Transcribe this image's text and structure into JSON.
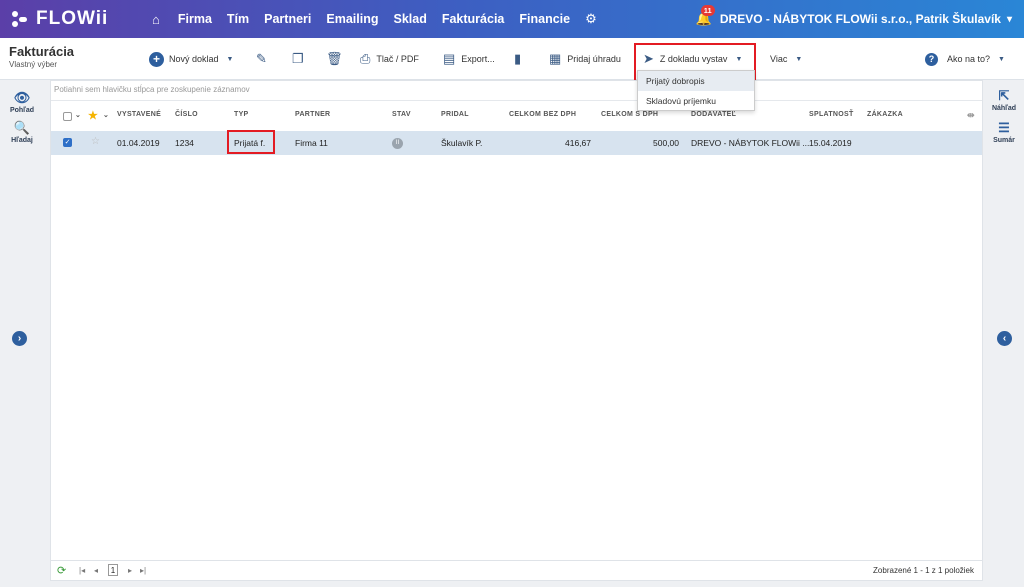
{
  "topbar": {
    "logo_text": "FLOWii",
    "nav": [
      "Firma",
      "Tím",
      "Partneri",
      "Emailing",
      "Sklad",
      "Fakturácia",
      "Financie"
    ],
    "notifications": "11",
    "user": "DREVO - NÁBYTOK FLOWii s.r.o., Patrik Škulavík"
  },
  "page": {
    "title": "Fakturácia",
    "subtitle": "Vlastný výber"
  },
  "toolbar": {
    "new_doc": "Nový doklad",
    "print": "Tlač / PDF",
    "export": "Export...",
    "add_payment": "Pridaj úhradu",
    "from_doc": "Z dokladu vystav",
    "more": "Viac",
    "help": "Ako na to?"
  },
  "dropdown": [
    "Prijatý dobropis",
    "Skladovú príjemku"
  ],
  "rails": {
    "left": {
      "view": "Pohľad",
      "search": "Hľadaj"
    },
    "right": {
      "preview": "Náhľad",
      "summary": "Sumár"
    }
  },
  "grid": {
    "group_hint": "Potiahni sem hlavičku stĺpca pre zoskupenie záznamov",
    "columns": [
      "VYSTAVENÉ",
      "ČÍSLO",
      "TYP",
      "PARTNER",
      "STAV",
      "PRIDAL",
      "CELKOM BEZ DPH",
      "CELKOM S DPH",
      "DODÁVATEĽ",
      "SPLATNOSŤ",
      "ZÁKAZKA"
    ],
    "rows": [
      {
        "issued": "01.04.2019",
        "number": "1234",
        "type": "Prijatá f.",
        "partner": "Firma 11",
        "added_by": "Škulavík P.",
        "total_net": "416,67",
        "total_gross": "500,00",
        "supplier": "DREVO - NÁBYTOK FLOWii ...",
        "due": "15.04.2019"
      }
    ]
  },
  "footer": {
    "page": "1",
    "summary": "Zobrazené 1 - 1 z 1 položiek"
  }
}
